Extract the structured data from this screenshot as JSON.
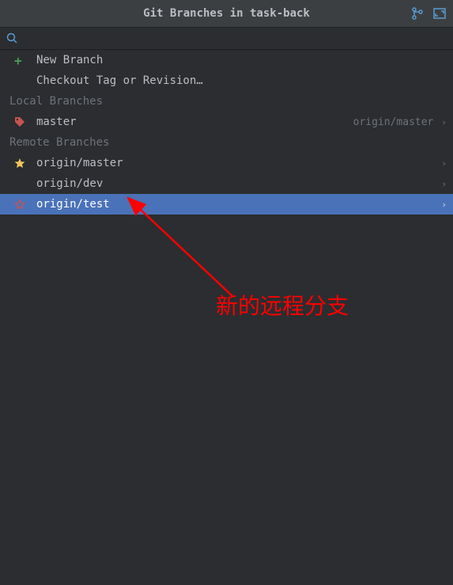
{
  "titlebar": {
    "title": "Git Branches in task-back"
  },
  "actions": {
    "new_branch": "New Branch",
    "checkout_tag": "Checkout Tag or Revision…"
  },
  "sections": {
    "local": "Local Branches",
    "remote": "Remote Branches"
  },
  "local_branches": {
    "master": {
      "name": "master",
      "tracking": "origin/master"
    }
  },
  "remote_branches": {
    "origin_master": "origin/master",
    "origin_dev": "origin/dev",
    "origin_test": "origin/test"
  },
  "annotation": {
    "text": "新的远程分支"
  },
  "colors": {
    "bg": "#2b2d30",
    "titlebar_bg": "#3c3f41",
    "selected_bg": "#4a72b8",
    "text": "#bcbec4",
    "muted": "#6f737a",
    "green": "#499c54",
    "red": "#c75450",
    "yellow": "#f2c55c",
    "blue": "#5a9bd4",
    "annotation": "#ff0000"
  }
}
